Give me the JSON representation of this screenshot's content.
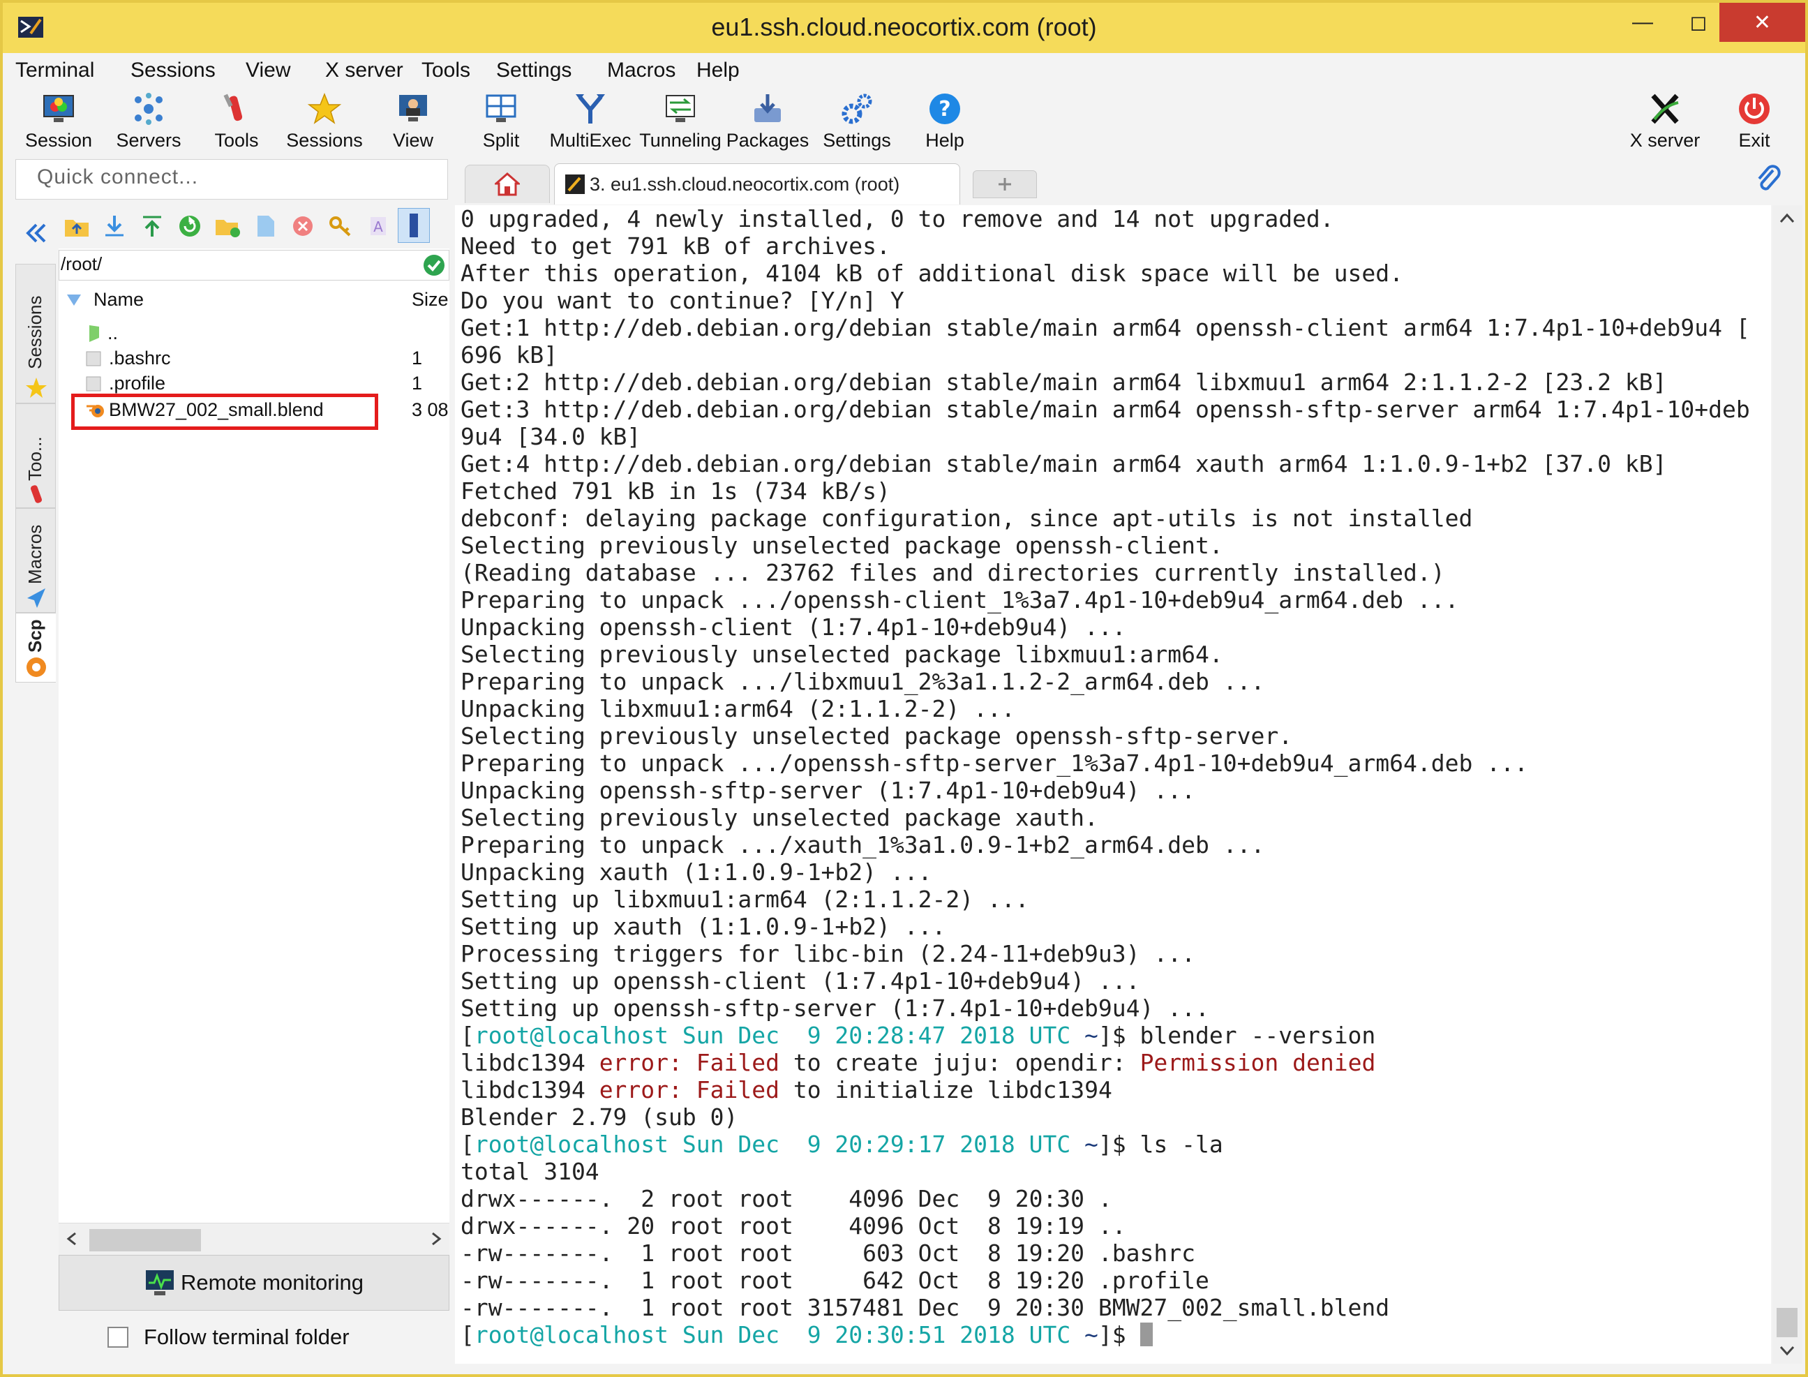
{
  "window": {
    "title": "eu1.ssh.cloud.neocortix.com (root)",
    "min": "—",
    "max": "◻",
    "close": "✕"
  },
  "menu": [
    "Terminal",
    "Sessions",
    "View",
    "X server",
    "Tools",
    "Settings",
    "Macros",
    "Help"
  ],
  "toolbar": {
    "session": "Session",
    "servers": "Servers",
    "tools": "Tools",
    "sessions": "Sessions",
    "view": "View",
    "split": "Split",
    "multiexec": "MultiExec",
    "tunneling": "Tunneling",
    "packages": "Packages",
    "settings": "Settings",
    "help": "Help",
    "xserver": "X server",
    "exit": "Exit"
  },
  "quick_connect": {
    "placeholder": "Quick connect..."
  },
  "tabs": {
    "active_label": "3. eu1.ssh.cloud.neocortix.com (root)"
  },
  "side_tabs": [
    "Sessions",
    "Too...",
    "Macros",
    "Scp"
  ],
  "file_panel": {
    "path": "/root/",
    "col_name": "Name",
    "col_size": "Size",
    "rows": [
      {
        "name": "..",
        "size": ""
      },
      {
        "name": ".bashrc",
        "size": "1"
      },
      {
        "name": ".profile",
        "size": "1"
      },
      {
        "name": "BMW27_002_small.blend",
        "size": "3 08"
      }
    ],
    "remote_monitoring": "Remote monitoring",
    "follow_terminal": "Follow terminal folder"
  },
  "colors": {
    "titlebar": "#f5db5a",
    "close": "#c93b2f",
    "prompt": "#14a5a5",
    "prompt_path": "#1b3a7a",
    "error": "#9c1919",
    "highlight": "#e41c1c"
  },
  "terminal": {
    "lines": [
      [
        {
          "t": "0 upgraded, 4 newly installed, 0 to remove and 14 not upgraded."
        }
      ],
      [
        {
          "t": "Need to get 791 kB of archives."
        }
      ],
      [
        {
          "t": "After this operation, 4104 kB of additional disk space will be used."
        }
      ],
      [
        {
          "t": "Do you want to continue? [Y/n] Y"
        }
      ],
      [
        {
          "t": "Get:1 http://deb.debian.org/debian stable/main arm64 openssh-client arm64 1:7.4p1-10+deb9u4 ["
        }
      ],
      [
        {
          "t": "696 kB]"
        }
      ],
      [
        {
          "t": "Get:2 http://deb.debian.org/debian stable/main arm64 libxmuu1 arm64 2:1.1.2-2 [23.2 kB]"
        }
      ],
      [
        {
          "t": "Get:3 http://deb.debian.org/debian stable/main arm64 openssh-sftp-server arm64 1:7.4p1-10+deb"
        }
      ],
      [
        {
          "t": "9u4 [34.0 kB]"
        }
      ],
      [
        {
          "t": "Get:4 http://deb.debian.org/debian stable/main arm64 xauth arm64 1:1.0.9-1+b2 [37.0 kB]"
        }
      ],
      [
        {
          "t": "Fetched 791 kB in 1s (734 kB/s)"
        }
      ],
      [
        {
          "t": "debconf: delaying package configuration, since apt-utils is not installed"
        }
      ],
      [
        {
          "t": "Selecting previously unselected package openssh-client."
        }
      ],
      [
        {
          "t": "(Reading database ... 23762 files and directories currently installed.)"
        }
      ],
      [
        {
          "t": "Preparing to unpack .../openssh-client_1%3a7.4p1-10+deb9u4_arm64.deb ..."
        }
      ],
      [
        {
          "t": "Unpacking openssh-client (1:7.4p1-10+deb9u4) ..."
        }
      ],
      [
        {
          "t": "Selecting previously unselected package libxmuu1:arm64."
        }
      ],
      [
        {
          "t": "Preparing to unpack .../libxmuu1_2%3a1.1.2-2_arm64.deb ..."
        }
      ],
      [
        {
          "t": "Unpacking libxmuu1:arm64 (2:1.1.2-2) ..."
        }
      ],
      [
        {
          "t": "Selecting previously unselected package openssh-sftp-server."
        }
      ],
      [
        {
          "t": "Preparing to unpack .../openssh-sftp-server_1%3a7.4p1-10+deb9u4_arm64.deb ..."
        }
      ],
      [
        {
          "t": "Unpacking openssh-sftp-server (1:7.4p1-10+deb9u4) ..."
        }
      ],
      [
        {
          "t": "Selecting previously unselected package xauth."
        }
      ],
      [
        {
          "t": "Preparing to unpack .../xauth_1%3a1.0.9-1+b2_arm64.deb ..."
        }
      ],
      [
        {
          "t": "Unpacking xauth (1:1.0.9-1+b2) ..."
        }
      ],
      [
        {
          "t": "Setting up libxmuu1:arm64 (2:1.1.2-2) ..."
        }
      ],
      [
        {
          "t": "Setting up xauth (1:1.0.9-1+b2) ..."
        }
      ],
      [
        {
          "t": "Processing triggers for libc-bin (2.24-11+deb9u3) ..."
        }
      ],
      [
        {
          "t": "Setting up openssh-client (1:7.4p1-10+deb9u4) ..."
        }
      ],
      [
        {
          "t": "Setting up openssh-sftp-server (1:7.4p1-10+deb9u4) ..."
        }
      ],
      [
        {
          "t": "["
        },
        {
          "t": "root@localhost Sun Dec  9 20:28:47 2018 UTC",
          "c": "teal"
        },
        {
          "t": " ~",
          "c": "navy"
        },
        {
          "t": "]$ blender --version"
        }
      ],
      [
        {
          "t": "libdc1394 "
        },
        {
          "t": "error:",
          "c": "red"
        },
        {
          "t": " "
        },
        {
          "t": "Failed",
          "c": "red"
        },
        {
          "t": " to create juju: opendir: "
        },
        {
          "t": "Permission denied",
          "c": "red"
        }
      ],
      [
        {
          "t": "libdc1394 "
        },
        {
          "t": "error:",
          "c": "red"
        },
        {
          "t": " "
        },
        {
          "t": "Failed",
          "c": "red"
        },
        {
          "t": " to initialize libdc1394"
        }
      ],
      [
        {
          "t": "Blender 2.79 (sub 0)"
        }
      ],
      [
        {
          "t": "["
        },
        {
          "t": "root@localhost Sun Dec  9 20:29:17 2018 UTC",
          "c": "teal"
        },
        {
          "t": " ~",
          "c": "navy"
        },
        {
          "t": "]$ ls -la"
        }
      ],
      [
        {
          "t": "total 3104"
        }
      ],
      [
        {
          "t": "drwx------.  2 root root    4096 Dec  9 20:30 ."
        }
      ],
      [
        {
          "t": "drwx------. 20 root root    4096 Oct  8 19:19 .."
        }
      ],
      [
        {
          "t": "-rw-------.  1 root root     603 Oct  8 19:20 .bashrc"
        }
      ],
      [
        {
          "t": "-rw-------.  1 root root     642 Oct  8 19:20 .profile"
        }
      ],
      [
        {
          "t": "-rw-------.  1 root root 3157481 Dec  9 20:30 BMW27_002_small.blend"
        }
      ],
      [
        {
          "t": "["
        },
        {
          "t": "root@localhost Sun Dec  9 20:30:51 2018 UTC",
          "c": "teal"
        },
        {
          "t": " ~",
          "c": "navy"
        },
        {
          "t": "]$ "
        }
      ]
    ]
  }
}
